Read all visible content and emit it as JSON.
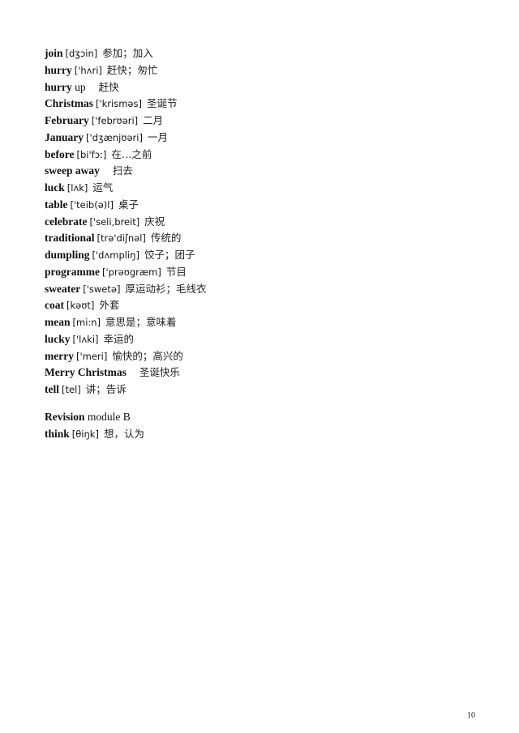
{
  "entries": [
    {
      "word": "join",
      "phonetic": "[dʒɔin]",
      "meaning": "参加；加入"
    },
    {
      "word": "hurry",
      "phonetic": "['hʌri]",
      "meaning": "赶快；匆忙"
    },
    {
      "word": "hurry",
      "phrase_rest": "up",
      "phonetic": "",
      "meaning": "赶快"
    },
    {
      "word": "Christmas",
      "phonetic": "['krisməs]",
      "meaning": "圣诞节"
    },
    {
      "word": "February",
      "phonetic": "['febrʊəri]",
      "meaning": "二月"
    },
    {
      "word": "January",
      "phonetic": "['dʒænjʊəri]",
      "meaning": "一月"
    },
    {
      "word": "before",
      "phonetic": "[bi'fɔ:]",
      "meaning": "在…之前"
    },
    {
      "word": "sweep away",
      "phonetic": "",
      "meaning": "扫去"
    },
    {
      "word": "luck",
      "phonetic": "[lʌk]",
      "meaning": "运气"
    },
    {
      "word": "table",
      "phonetic": "['teib(ə)l]",
      "meaning": "桌子"
    },
    {
      "word": "celebrate",
      "phonetic": "['seli,breit]",
      "meaning": "庆祝"
    },
    {
      "word": "traditional",
      "phonetic": "[trə'diʃnəl]",
      "meaning": "传统的"
    },
    {
      "word": "dumpling",
      "phonetic": "['dʌmpliŋ]",
      "meaning": "饺子；团子"
    },
    {
      "word": "programme",
      "phonetic": "['prəʊgræm]",
      "meaning": "节目"
    },
    {
      "word": "sweater",
      "phonetic": "['swetə]",
      "meaning": "厚运动衫；毛线衣"
    },
    {
      "word": "coat",
      "phonetic": "[kəʊt]",
      "meaning": "外套"
    },
    {
      "word": "mean",
      "phonetic": "[mi:n]",
      "meaning": "意思是；意味着"
    },
    {
      "word": "lucky",
      "phonetic": "['lʌki]",
      "meaning": "幸运的"
    },
    {
      "word": "merry",
      "phonetic": "['meri]",
      "meaning": "愉快的；高兴的"
    },
    {
      "word": "Merry Christmas",
      "phonetic": "",
      "meaning": "圣诞快乐"
    },
    {
      "word": "tell",
      "phonetic": "[tel]",
      "meaning": "讲；告诉"
    }
  ],
  "section": {
    "heading_bold": "Revision",
    "heading_rest": "module B",
    "entries": [
      {
        "word": "think",
        "phonetic": "[θiŋk]",
        "meaning": "想，认为"
      }
    ]
  },
  "page_number": "10"
}
